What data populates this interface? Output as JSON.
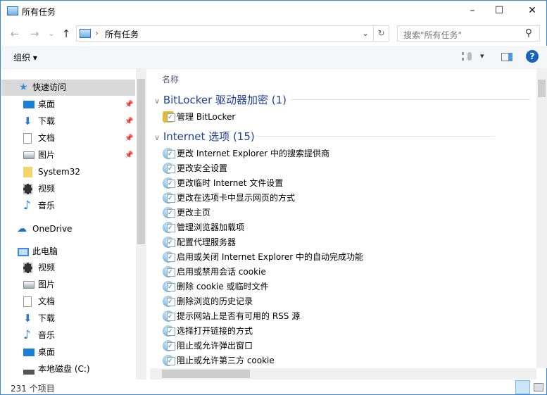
{
  "window": {
    "title": "所有任务",
    "minimize": "–",
    "maximize": "☐",
    "close": "✕"
  },
  "nav": {
    "back": "←",
    "forward": "→",
    "recent": "⌄",
    "up": "↑",
    "address_sep": "›",
    "address": "所有任务",
    "dropdown": "⌄",
    "refresh": "↻",
    "search_placeholder": "搜索\"所有任务\"",
    "search_icon": "⚲"
  },
  "ribbon": {
    "organize": "组织 ▾",
    "view_icon": "view-list-icon",
    "view_dropdown": "▾",
    "help": "?"
  },
  "sidebar": {
    "quick_access": "快速访问",
    "quick_items": [
      {
        "label": "桌面",
        "icon": "desktop-icon",
        "pinned": true
      },
      {
        "label": "下载",
        "icon": "download-icon",
        "pinned": true
      },
      {
        "label": "文档",
        "icon": "document-icon",
        "pinned": true
      },
      {
        "label": "图片",
        "icon": "picture-icon",
        "pinned": true
      },
      {
        "label": "System32",
        "icon": "folder-icon",
        "pinned": false
      },
      {
        "label": "视频",
        "icon": "video-icon",
        "pinned": false
      },
      {
        "label": "音乐",
        "icon": "music-icon",
        "pinned": false
      }
    ],
    "onedrive": "OneDrive",
    "this_pc": "此电脑",
    "pc_items": [
      {
        "label": "视频",
        "icon": "video-icon"
      },
      {
        "label": "图片",
        "icon": "picture-icon"
      },
      {
        "label": "文档",
        "icon": "document-icon"
      },
      {
        "label": "下载",
        "icon": "download-icon"
      },
      {
        "label": "音乐",
        "icon": "music-icon"
      },
      {
        "label": "桌面",
        "icon": "desktop-icon"
      },
      {
        "label": "本地磁盘 (C:)",
        "icon": "drive-icon"
      }
    ]
  },
  "content": {
    "column_name": "名称",
    "groups": [
      {
        "title": "BitLocker 驱动器加密 (1)",
        "items": [
          "管理 BitLocker"
        ]
      },
      {
        "title": "Internet 选项 (15)",
        "items": [
          "更改 Internet Explorer 中的搜索提供商",
          "更改安全设置",
          "更改临时 Internet 文件设置",
          "更改在选项卡中显示网页的方式",
          "更改主页",
          "管理浏览器加载项",
          "配置代理服务器",
          "启用或关闭 Internet Explorer 中的自动完成功能",
          "启用或禁用会话 cookie",
          "删除 cookie 或临时文件",
          "删除浏览的历史记录",
          "提示网站上是否有可用的 RSS 源",
          "选择打开链接的方式",
          "阻止或允许弹出窗口",
          "阻止或允许第三方 cookie"
        ]
      }
    ]
  },
  "status": {
    "count": "231 个项目"
  },
  "colors": {
    "accent": "#1e3f9e",
    "selected": "#d9d9d9",
    "border": "#3a8ad8"
  }
}
